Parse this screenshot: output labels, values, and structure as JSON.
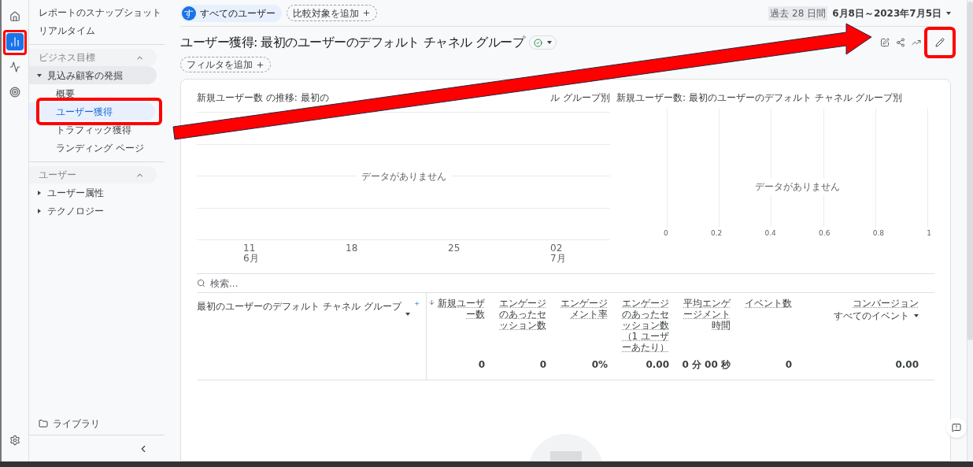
{
  "rail": [
    {
      "selected": false,
      "highlighted": false
    },
    {
      "selected": true,
      "highlighted": true
    },
    {
      "selected": false,
      "highlighted": false
    },
    {
      "selected": false,
      "highlighted": false
    }
  ],
  "sidebar": {
    "top_items": [
      {
        "label": "レポートのスナップショット",
        "selected": false
      },
      {
        "label": "リアルタイム",
        "selected": false
      }
    ],
    "sections": [
      {
        "title": "ビジネス目標",
        "expanded": true,
        "children": [
          {
            "label": "見込み顧客の発掘",
            "expanded": true,
            "children": [
              {
                "label": "概要",
                "selected": false,
                "highlighted": false
              },
              {
                "label": "ユーザー獲得",
                "selected": true,
                "highlighted": true
              },
              {
                "label": "トラフィック獲得",
                "selected": false,
                "highlighted": false
              },
              {
                "label": "ランディング ページ",
                "selected": false,
                "highlighted": false
              }
            ]
          }
        ]
      },
      {
        "title": "ユーザー",
        "expanded": true,
        "children": [
          {
            "label": "ユーザー属性",
            "expanded": false
          },
          {
            "label": "テクノロジー",
            "expanded": false
          }
        ]
      }
    ],
    "library": "ライブラリ"
  },
  "top_bar": {
    "segment": {
      "badge": "す",
      "label": "すべてのユーザー"
    },
    "compare": "比較対象を追加",
    "period": "過去 28 日間",
    "date_range": "6月8日～2023年7月5日"
  },
  "report": {
    "title": "ユーザー獲得: 最初のユーザーのデフォルト チャネル グループ",
    "filter": "フィルタを追加",
    "edit_highlighted": true,
    "annotation_arrow": true
  },
  "line_chart": {
    "title_start": "新規ユーザー数 の推移: 最初の",
    "title_end": "ル グループ別",
    "empty": "データがありません",
    "x_labels": [
      {
        "day": "11",
        "month": "6月"
      },
      {
        "day": "18"
      },
      {
        "day": "25"
      },
      {
        "day": "02",
        "month": "7月"
      }
    ]
  },
  "bar_chart": {
    "title": "新規ユーザー数: 最初のユーザーのデフォルト チャネル グループ別",
    "empty": "データがありません",
    "x_ticks": [
      "0",
      "0.2",
      "0.4",
      "0.6",
      "0.8",
      "1"
    ]
  },
  "table": {
    "search_placeholder": "検索...",
    "dimension": "最初のユーザーのデフォルト チャネル グループ",
    "columns": [
      {
        "label": "新規ユーザー数",
        "sorted": true
      },
      {
        "label": "エンゲージのあったセッション数",
        "sorted": false
      },
      {
        "label": "エンゲージメント率",
        "sorted": false
      },
      {
        "label": "エンゲージのあったセッション数（1 ユーザーあたり）",
        "sorted": false
      },
      {
        "label": "平均エンゲージメント時間",
        "sorted": false
      },
      {
        "label": "イベント数",
        "sorted": false
      },
      {
        "label": "コンバージョン",
        "sub": "すべてのイベント",
        "sorted": false
      }
    ],
    "totals": [
      "0",
      "0",
      "0%",
      "0.00",
      "0 分 00 秒",
      "0",
      "0.00"
    ]
  }
}
